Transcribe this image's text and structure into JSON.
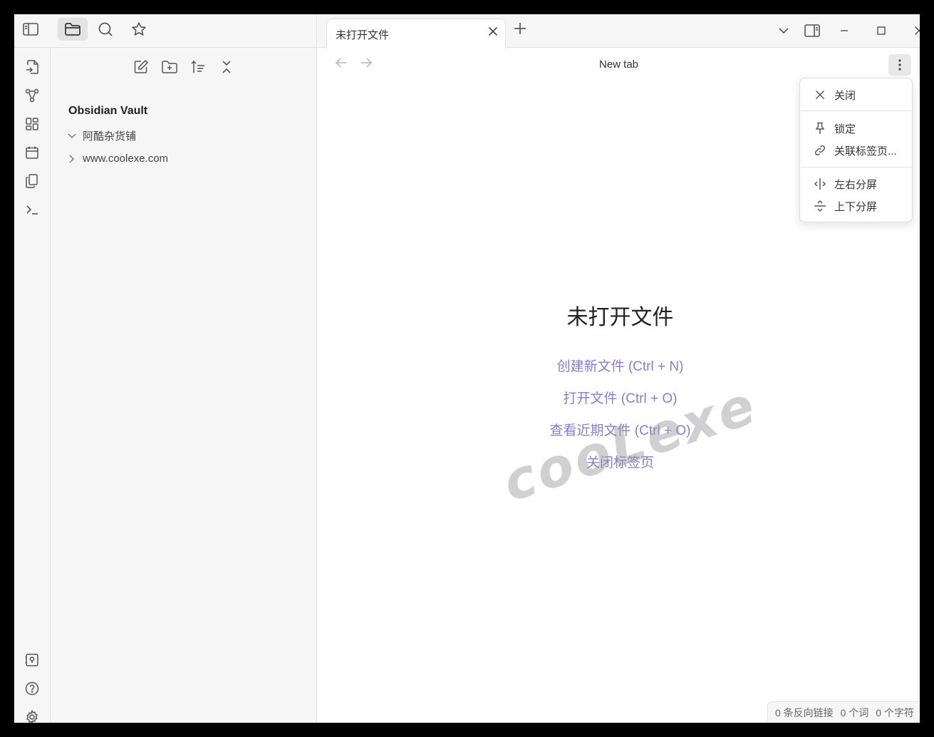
{
  "tab": {
    "title": "未打开文件"
  },
  "view": {
    "title": "New tab"
  },
  "explorer": {
    "vault_name": "Obsidian Vault",
    "items": [
      {
        "label": "阿酷杂货铺"
      },
      {
        "label": "www.coolexe.com"
      }
    ]
  },
  "empty_state": {
    "title": "未打开文件",
    "actions": [
      {
        "label": "创建新文件 (Ctrl + N)"
      },
      {
        "label": "打开文件 (Ctrl + O)"
      },
      {
        "label": "查看近期文件 (Ctrl + O)"
      },
      {
        "label": "关闭标签页"
      }
    ]
  },
  "menu": {
    "close": "关闭",
    "pin": "锁定",
    "link_tab": "关联标签页...",
    "split_right": "左右分屏",
    "split_down": "上下分屏"
  },
  "status": {
    "backlinks": "0 条反向链接",
    "words": "0 个词",
    "chars": "0 个字符"
  },
  "watermark": "cooLexe",
  "colors": {
    "accent": "#8a7dc9",
    "panel": "#f6f6f6",
    "border": "#e0e0e0"
  }
}
